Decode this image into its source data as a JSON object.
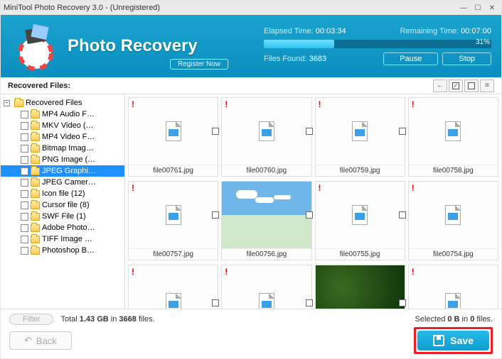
{
  "window": {
    "title": "MiniTool Photo Recovery 3.0 - (Unregistered)"
  },
  "header": {
    "app_title": "Photo Recovery",
    "register": "Register Now",
    "elapsed_label": "Elapsed Time:",
    "elapsed_value": "00:03:34",
    "remaining_label": "Remaining Time:",
    "remaining_value": "00:07:00",
    "progress_pct": "31%",
    "found_label": "Files Found:",
    "found_value": "3683",
    "pause": "Pause",
    "stop": "Stop"
  },
  "toolbar": {
    "label": "Recovered Files:"
  },
  "tree": {
    "root": "Recovered Files",
    "items": [
      "MP4 Audio F…",
      "MKV Video (…",
      "MP4 Video F…",
      "Bitmap Imag…",
      "PNG Image (…",
      "JPEG Graphi…",
      "JPEG Camer…",
      "Icon file (12)",
      "Cursor file (8)",
      "SWF File (1)",
      "Adobe Photo…",
      "TIFF Image …",
      "Photoshop B…"
    ],
    "selected_index": 5
  },
  "thumbs": [
    {
      "name": "file00761.jpg",
      "preview": "placeholder"
    },
    {
      "name": "file00760.jpg",
      "preview": "placeholder"
    },
    {
      "name": "file00759.jpg",
      "preview": "placeholder"
    },
    {
      "name": "file00758.jpg",
      "preview": "placeholder"
    },
    {
      "name": "file00757.jpg",
      "preview": "placeholder"
    },
    {
      "name": "file00756.jpg",
      "preview": "sky"
    },
    {
      "name": "file00755.jpg",
      "preview": "placeholder"
    },
    {
      "name": "file00754.jpg",
      "preview": "placeholder"
    },
    {
      "name": "",
      "preview": "placeholder"
    },
    {
      "name": "",
      "preview": "placeholder"
    },
    {
      "name": "",
      "preview": "leaves"
    },
    {
      "name": "",
      "preview": "placeholder"
    }
  ],
  "footer": {
    "filter": "Filter",
    "total_prefix": "Total ",
    "total_size": "1.43 GB",
    "total_mid": " in ",
    "total_files": "3668",
    "total_suffix": " files.",
    "selected_prefix": "Selected ",
    "selected_size": "0 B",
    "selected_mid": " in ",
    "selected_files": "0",
    "selected_suffix": " files.",
    "back": "Back",
    "save": "Save"
  }
}
